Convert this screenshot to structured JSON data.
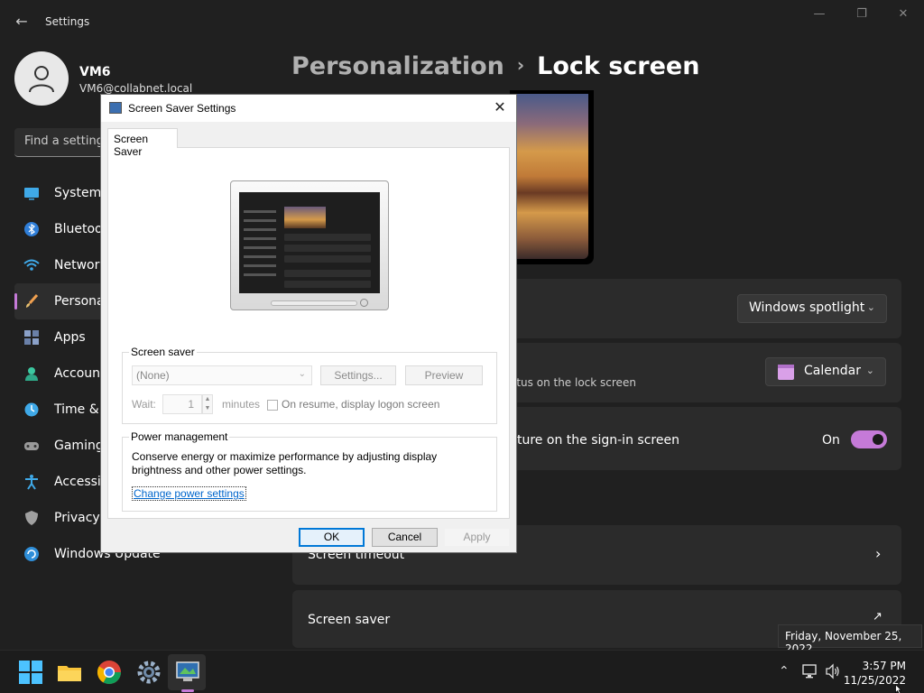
{
  "window": {
    "title": "Settings"
  },
  "profile": {
    "name": "VM6",
    "email": "VM6@collabnet.local"
  },
  "search": {
    "placeholder": "Find a setting"
  },
  "nav": {
    "items": [
      {
        "label": "System",
        "icon": "system-icon"
      },
      {
        "label": "Bluetooth & devices",
        "icon": "bluetooth-icon"
      },
      {
        "label": "Network & internet",
        "icon": "network-icon"
      },
      {
        "label": "Personalization",
        "icon": "personalization-icon",
        "active": true
      },
      {
        "label": "Apps",
        "icon": "apps-icon"
      },
      {
        "label": "Accounts",
        "icon": "accounts-icon"
      },
      {
        "label": "Time & language",
        "icon": "time-icon"
      },
      {
        "label": "Gaming",
        "icon": "gaming-icon"
      },
      {
        "label": "Accessibility",
        "icon": "accessibility-icon"
      },
      {
        "label": "Privacy & security",
        "icon": "privacy-icon"
      },
      {
        "label": "Windows Update",
        "icon": "windows-update-icon"
      }
    ]
  },
  "header": {
    "parent": "Personalization",
    "separator": "›",
    "current": "Lock screen"
  },
  "cards": {
    "personalize_value": "Windows spotlight",
    "status_text": "atus on the lock screen",
    "status_value": "Calendar",
    "signin_text": "ture on the sign-in screen",
    "signin_state": "On",
    "screen_timeout": "Screen timeout",
    "screen_saver": "Screen saver"
  },
  "dialog": {
    "title": "Screen Saver Settings",
    "tab": "Screen Saver",
    "screen_saver_group": "Screen saver",
    "selected": "(None)",
    "settings_btn": "Settings...",
    "preview_btn": "Preview",
    "wait_label": "Wait:",
    "wait_value": "1",
    "minutes": "minutes",
    "resume_label": "On resume, display logon screen",
    "power_group": "Power management",
    "power_text": "Conserve energy or maximize performance by adjusting display brightness and other power settings.",
    "power_link": "Change power settings",
    "ok": "OK",
    "cancel": "Cancel",
    "apply": "Apply"
  },
  "flyout": {
    "date": "Friday, November 25, 2022"
  },
  "taskbar": {
    "time": "3:57 PM",
    "date": "11/25/2022"
  },
  "colors": {
    "accent": "#c57ad8",
    "background": "#202020",
    "card": "#2b2b2b"
  }
}
